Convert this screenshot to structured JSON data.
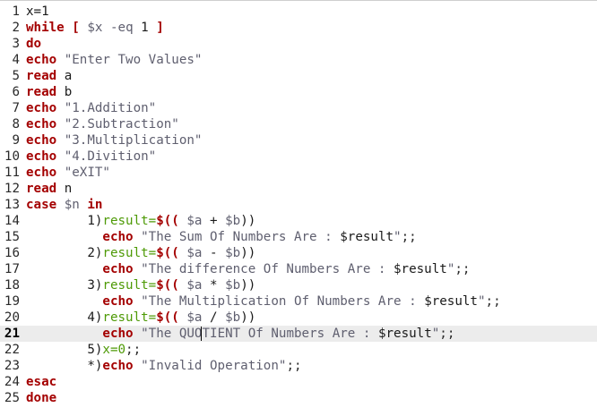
{
  "editor": {
    "current_line": 21,
    "lines": [
      {
        "num": "1",
        "tokens": [
          {
            "t": "x=1",
            "c": "plain"
          }
        ]
      },
      {
        "num": "2",
        "tokens": [
          {
            "t": "while",
            "c": "kw"
          },
          {
            "t": " ",
            "c": "plain"
          },
          {
            "t": "[",
            "c": "brkt"
          },
          {
            "t": " ",
            "c": "plain"
          },
          {
            "t": "$x",
            "c": "var"
          },
          {
            "t": " ",
            "c": "plain"
          },
          {
            "t": "-eq",
            "c": "var"
          },
          {
            "t": " 1 ",
            "c": "plain"
          },
          {
            "t": "]",
            "c": "brkt"
          }
        ]
      },
      {
        "num": "3",
        "tokens": [
          {
            "t": "do",
            "c": "kw"
          }
        ]
      },
      {
        "num": "4",
        "tokens": [
          {
            "t": "echo",
            "c": "kw"
          },
          {
            "t": " ",
            "c": "plain"
          },
          {
            "t": "\"Enter Two Values\"",
            "c": "str"
          }
        ]
      },
      {
        "num": "5",
        "tokens": [
          {
            "t": "read",
            "c": "kw"
          },
          {
            "t": " a",
            "c": "plain"
          }
        ]
      },
      {
        "num": "6",
        "tokens": [
          {
            "t": "read",
            "c": "kw"
          },
          {
            "t": " b",
            "c": "plain"
          }
        ]
      },
      {
        "num": "7",
        "tokens": [
          {
            "t": "echo",
            "c": "kw"
          },
          {
            "t": " ",
            "c": "plain"
          },
          {
            "t": "\"1.Addition\"",
            "c": "str"
          }
        ]
      },
      {
        "num": "8",
        "tokens": [
          {
            "t": "echo",
            "c": "kw"
          },
          {
            "t": " ",
            "c": "plain"
          },
          {
            "t": "\"2.Subtraction\"",
            "c": "str"
          }
        ]
      },
      {
        "num": "9",
        "tokens": [
          {
            "t": "echo",
            "c": "kw"
          },
          {
            "t": " ",
            "c": "plain"
          },
          {
            "t": "\"3.Multiplication\"",
            "c": "str"
          }
        ]
      },
      {
        "num": "10",
        "tokens": [
          {
            "t": "echo",
            "c": "kw"
          },
          {
            "t": " ",
            "c": "plain"
          },
          {
            "t": "\"4.Divition\"",
            "c": "str"
          }
        ]
      },
      {
        "num": "11",
        "tokens": [
          {
            "t": "echo",
            "c": "kw"
          },
          {
            "t": " ",
            "c": "plain"
          },
          {
            "t": "\"eXIT\"",
            "c": "str"
          }
        ]
      },
      {
        "num": "12",
        "tokens": [
          {
            "t": "read",
            "c": "kw"
          },
          {
            "t": " n",
            "c": "plain"
          }
        ]
      },
      {
        "num": "13",
        "tokens": [
          {
            "t": "case",
            "c": "kw"
          },
          {
            "t": " ",
            "c": "plain"
          },
          {
            "t": "$n",
            "c": "var"
          },
          {
            "t": " ",
            "c": "plain"
          },
          {
            "t": "in",
            "c": "kw"
          }
        ]
      },
      {
        "num": "14",
        "tokens": [
          {
            "t": "        1)",
            "c": "plain"
          },
          {
            "t": "result=",
            "c": "assign"
          },
          {
            "t": "$((",
            "c": "sub-open"
          },
          {
            "t": " ",
            "c": "plain"
          },
          {
            "t": "$a",
            "c": "var"
          },
          {
            "t": " + ",
            "c": "plain"
          },
          {
            "t": "$b",
            "c": "var"
          },
          {
            "t": "))",
            "c": "plain"
          }
        ]
      },
      {
        "num": "15",
        "tokens": [
          {
            "t": "          ",
            "c": "plain"
          },
          {
            "t": "echo",
            "c": "kw"
          },
          {
            "t": " ",
            "c": "plain"
          },
          {
            "t": "\"The Sum Of Numbers Are : ",
            "c": "str"
          },
          {
            "t": "$result",
            "c": "plain"
          },
          {
            "t": "\"",
            "c": "str"
          },
          {
            "t": ";;",
            "c": "semi"
          }
        ]
      },
      {
        "num": "16",
        "tokens": [
          {
            "t": "        2)",
            "c": "plain"
          },
          {
            "t": "result=",
            "c": "assign"
          },
          {
            "t": "$((",
            "c": "sub-open"
          },
          {
            "t": " ",
            "c": "plain"
          },
          {
            "t": "$a",
            "c": "var"
          },
          {
            "t": " - ",
            "c": "plain"
          },
          {
            "t": "$b",
            "c": "var"
          },
          {
            "t": "))",
            "c": "plain"
          }
        ]
      },
      {
        "num": "17",
        "tokens": [
          {
            "t": "          ",
            "c": "plain"
          },
          {
            "t": "echo",
            "c": "kw"
          },
          {
            "t": " ",
            "c": "plain"
          },
          {
            "t": "\"The difference Of Numbers Are : ",
            "c": "str"
          },
          {
            "t": "$result",
            "c": "plain"
          },
          {
            "t": "\"",
            "c": "str"
          },
          {
            "t": ";;",
            "c": "semi"
          }
        ]
      },
      {
        "num": "18",
        "tokens": [
          {
            "t": "        3)",
            "c": "plain"
          },
          {
            "t": "result=",
            "c": "assign"
          },
          {
            "t": "$((",
            "c": "sub-open"
          },
          {
            "t": " ",
            "c": "plain"
          },
          {
            "t": "$a",
            "c": "var"
          },
          {
            "t": " * ",
            "c": "plain"
          },
          {
            "t": "$b",
            "c": "var"
          },
          {
            "t": "))",
            "c": "plain"
          }
        ]
      },
      {
        "num": "19",
        "tokens": [
          {
            "t": "          ",
            "c": "plain"
          },
          {
            "t": "echo",
            "c": "kw"
          },
          {
            "t": " ",
            "c": "plain"
          },
          {
            "t": "\"The Multiplication Of Numbers Are : ",
            "c": "str"
          },
          {
            "t": "$result",
            "c": "plain"
          },
          {
            "t": "\"",
            "c": "str"
          },
          {
            "t": ";;",
            "c": "semi"
          }
        ]
      },
      {
        "num": "20",
        "tokens": [
          {
            "t": "        4)",
            "c": "plain"
          },
          {
            "t": "result=",
            "c": "assign"
          },
          {
            "t": "$((",
            "c": "sub-open"
          },
          {
            "t": " ",
            "c": "plain"
          },
          {
            "t": "$a",
            "c": "var"
          },
          {
            "t": " / ",
            "c": "plain"
          },
          {
            "t": "$b",
            "c": "var"
          },
          {
            "t": "))",
            "c": "plain"
          }
        ]
      },
      {
        "num": "21",
        "tokens": [
          {
            "t": "          ",
            "c": "plain"
          },
          {
            "t": "echo",
            "c": "kw"
          },
          {
            "t": " ",
            "c": "plain"
          },
          {
            "t": "\"The QUO",
            "c": "str"
          },
          {
            "t": "",
            "c": "cursor"
          },
          {
            "t": "TIENT Of Numbers Are : ",
            "c": "str"
          },
          {
            "t": "$result",
            "c": "plain"
          },
          {
            "t": "\"",
            "c": "str"
          },
          {
            "t": ";;",
            "c": "semi"
          }
        ]
      },
      {
        "num": "22",
        "tokens": [
          {
            "t": "        5)",
            "c": "plain"
          },
          {
            "t": "x=0",
            "c": "assign"
          },
          {
            "t": ";;",
            "c": "semi"
          }
        ]
      },
      {
        "num": "23",
        "tokens": [
          {
            "t": "        *)",
            "c": "plain"
          },
          {
            "t": "echo",
            "c": "kw"
          },
          {
            "t": " ",
            "c": "plain"
          },
          {
            "t": "\"Invalid Operation\"",
            "c": "str"
          },
          {
            "t": ";;",
            "c": "semi"
          }
        ]
      },
      {
        "num": "24",
        "tokens": [
          {
            "t": "esac",
            "c": "kw"
          }
        ]
      },
      {
        "num": "25",
        "tokens": [
          {
            "t": "done",
            "c": "kw"
          }
        ]
      }
    ]
  }
}
